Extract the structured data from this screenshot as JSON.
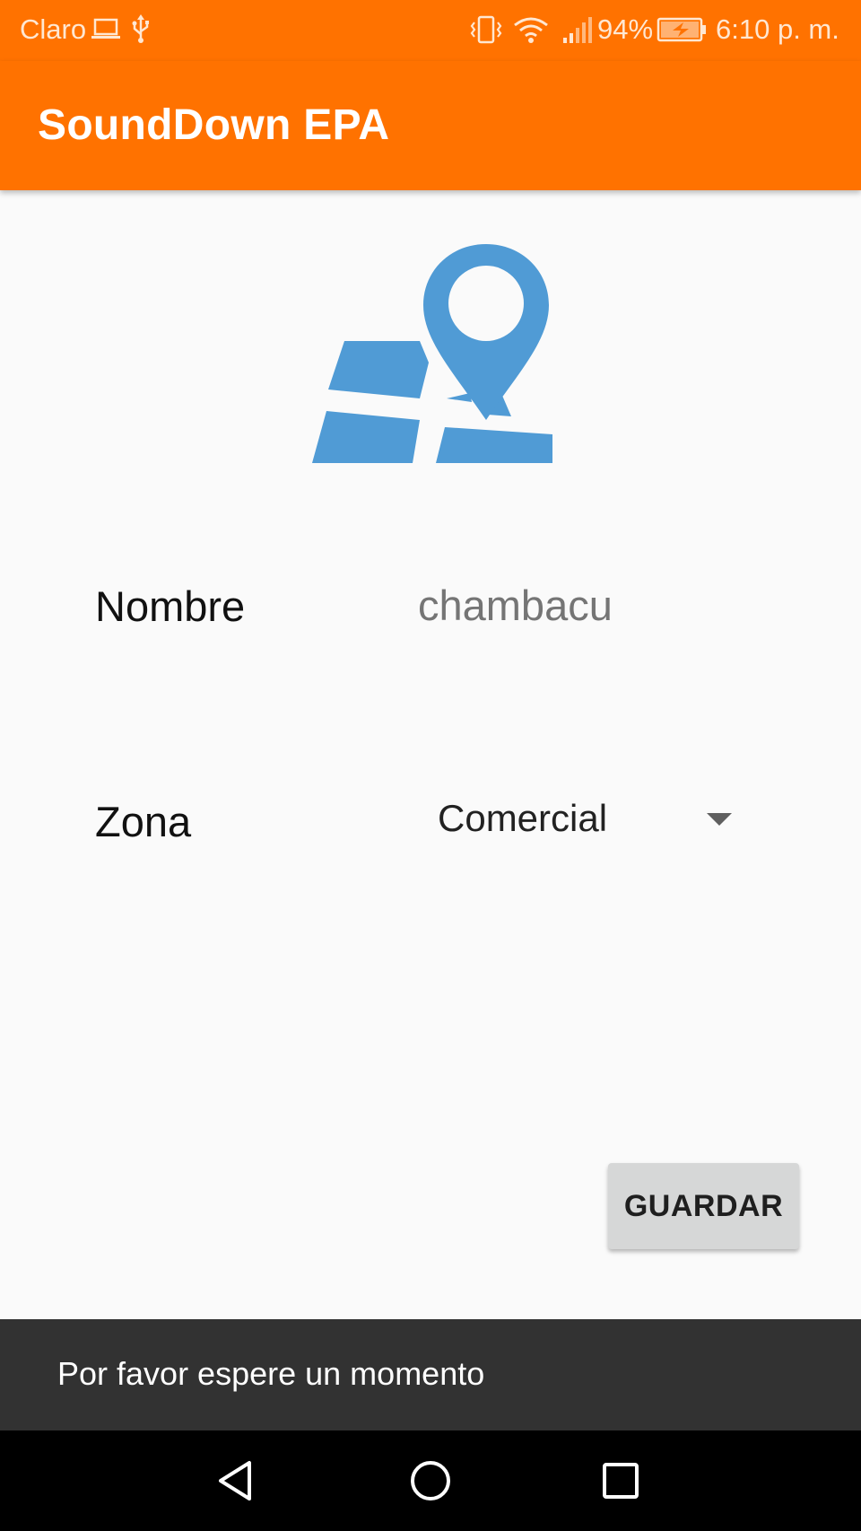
{
  "status_bar": {
    "carrier": "Claro",
    "battery_percent": "94%",
    "time": "6:10 p. m.",
    "icons": [
      "laptop-icon",
      "usb-icon",
      "vibrate-icon",
      "wifi-icon",
      "signal-icon",
      "battery-charging-icon"
    ]
  },
  "app_bar": {
    "title": "SoundDown EPA",
    "color": "#ff7200"
  },
  "hero": {
    "icon": "map-pin-icon",
    "color": "#509bd5"
  },
  "form": {
    "nombre_label": "Nombre",
    "nombre_value": "chambacu",
    "zona_label": "Zona",
    "zona_selected": "Comercial"
  },
  "actions": {
    "save_label": "GUARDAR"
  },
  "snackbar": {
    "message": "Por favor espere un momento"
  },
  "nav_bar": {
    "buttons": [
      "back-icon",
      "home-icon",
      "recents-icon"
    ]
  }
}
